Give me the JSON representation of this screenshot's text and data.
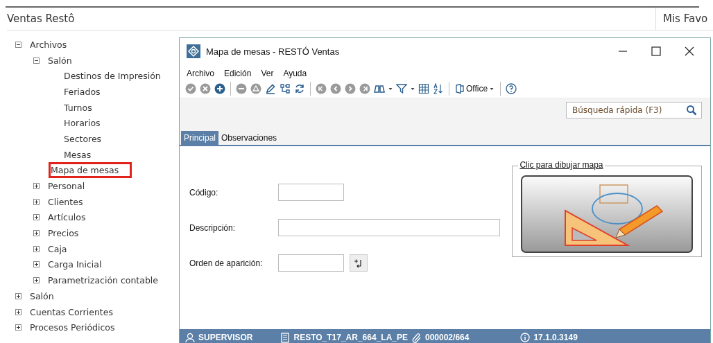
{
  "app": {
    "title": "Ventas Restô",
    "favorites_title": "Mis Favo"
  },
  "tree": [
    {
      "label": "Archivos",
      "kind": "folder",
      "expanded": true,
      "highlighted": false,
      "children": [
        {
          "label": "Salón",
          "kind": "folder",
          "expanded": true,
          "highlighted": false,
          "children": [
            {
              "label": "Destinos de Impresión",
              "kind": "leaf",
              "highlighted": false
            },
            {
              "label": "Feriados",
              "kind": "leaf",
              "highlighted": false
            },
            {
              "label": "Turnos",
              "kind": "leaf",
              "highlighted": false
            },
            {
              "label": "Horarios",
              "kind": "leaf",
              "highlighted": false
            },
            {
              "label": "Sectores",
              "kind": "leaf",
              "highlighted": false
            },
            {
              "label": "Mesas",
              "kind": "leaf",
              "highlighted": false
            },
            {
              "label": "Mapa de mesas",
              "kind": "leaf",
              "highlighted": true
            }
          ]
        },
        {
          "label": "Personal",
          "kind": "folder",
          "expanded": false,
          "highlighted": false
        },
        {
          "label": "Clientes",
          "kind": "folder",
          "expanded": false,
          "highlighted": false
        },
        {
          "label": "Artículos",
          "kind": "folder",
          "expanded": false,
          "highlighted": false
        },
        {
          "label": "Precios",
          "kind": "folder",
          "expanded": false,
          "highlighted": false
        },
        {
          "label": "Caja",
          "kind": "folder",
          "expanded": false,
          "highlighted": false
        },
        {
          "label": "Carga Inicial",
          "kind": "folder",
          "expanded": false,
          "highlighted": false
        },
        {
          "label": "Parametrización contable",
          "kind": "folder",
          "expanded": false,
          "highlighted": false
        }
      ]
    },
    {
      "label": "Salón",
      "kind": "folder",
      "expanded": false,
      "highlighted": false
    },
    {
      "label": "Cuentas Corrientes",
      "kind": "folder",
      "expanded": false,
      "highlighted": false
    },
    {
      "label": "Procesos Periódicos",
      "kind": "folder",
      "expanded": false,
      "highlighted": false
    }
  ],
  "window": {
    "title": "Mapa de mesas - RESTÓ Ventas",
    "menu": [
      "Archivo",
      "Edición",
      "Ver",
      "Ayuda"
    ],
    "toolbar": [
      {
        "kind": "confirm",
        "disabled": true
      },
      {
        "kind": "cancel",
        "disabled": true
      },
      {
        "kind": "add",
        "disabled": false
      },
      {
        "kind": "separator"
      },
      {
        "kind": "remove",
        "disabled": true
      },
      {
        "kind": "warning",
        "disabled": true
      },
      {
        "kind": "edit",
        "disabled": false
      },
      {
        "kind": "tree",
        "disabled": false
      },
      {
        "kind": "refresh",
        "disabled": false
      },
      {
        "kind": "separator"
      },
      {
        "kind": "first",
        "disabled": true
      },
      {
        "kind": "prev",
        "disabled": true
      },
      {
        "kind": "next",
        "disabled": true
      },
      {
        "kind": "last",
        "disabled": true
      },
      {
        "kind": "binoculars",
        "disabled": false
      },
      {
        "kind": "caret"
      },
      {
        "kind": "filter",
        "disabled": false
      },
      {
        "kind": "caret"
      },
      {
        "kind": "grid",
        "disabled": false
      },
      {
        "kind": "sort",
        "disabled": false
      },
      {
        "kind": "separator"
      },
      {
        "kind": "office",
        "label": "Office",
        "disabled": false
      },
      {
        "kind": "separator"
      },
      {
        "kind": "help",
        "disabled": false
      }
    ],
    "search": {
      "placeholder": "Búsqueda rápida (F3)"
    },
    "tabs": [
      {
        "label": "Principal",
        "selected": true
      },
      {
        "label": "Observaciones",
        "selected": false
      }
    ],
    "fields": [
      {
        "label": "Código:",
        "kind": "short"
      },
      {
        "label": "Descripción:",
        "kind": "long"
      },
      {
        "label": "Orden de aparición:",
        "kind": "order"
      }
    ],
    "map_group": {
      "legend": "Clic para dibujar mapa"
    },
    "status_bar": [
      {
        "kind": "user",
        "text": "SUPERVISOR"
      },
      {
        "kind": "database",
        "text": "RESTO_T17_AR_664_LA_PE"
      },
      {
        "kind": "clip",
        "text": "000002/664"
      },
      {
        "kind": "info",
        "text": "17.1.0.3149"
      }
    ]
  }
}
